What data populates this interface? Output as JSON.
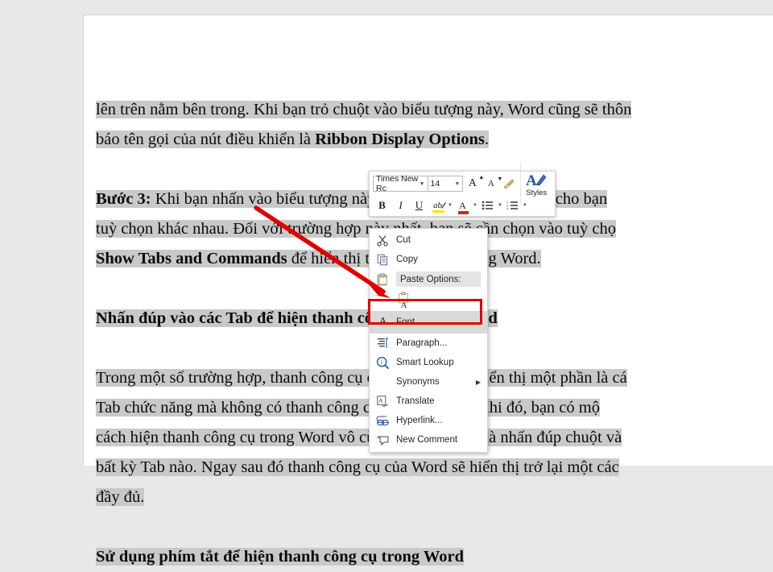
{
  "app": "Microsoft Word document with right-click context menu",
  "document": {
    "lines": [
      {
        "text": "lên trên nằm bên trong. Khi bạn trỏ chuột vào biểu tượng này, Word cũng sẽ thôn",
        "selected": true,
        "bold": false,
        "heading": false,
        "fullwidth": true
      },
      {
        "text": "báo tên gọi của nút điều khiển là ",
        "bold_tail": "Ribbon Display Options",
        "tail": ".",
        "selected": true,
        "bold": false,
        "heading": false,
        "fullwidth": false
      },
      {
        "text": "",
        "selected": false,
        "spacer": true
      },
      {
        "text_bold_lead": "Bước 3:",
        "text": " Khi bạn nhấn vào biểu tượng này trên Word, nó sẽ cung cấp cho bạn",
        "selected": true,
        "heading": false,
        "fullwidth": true
      },
      {
        "text": "tuỳ chọn khác nhau. Đối với trường hợp này nhất, bạn sẽ cần chọn vào tuỳ chọ",
        "selected": true,
        "heading": false,
        "fullwidth": true
      },
      {
        "text_bold_lead": "Show Tabs and Commands",
        "text": " để hiển thị thanh công cụ trong Word.",
        "selected": true,
        "heading": false,
        "fullwidth": false
      },
      {
        "text": "",
        "selected": false,
        "spacer": true
      },
      {
        "text": "Nhấn đúp vào các Tab để hiện thanh công cụ trong Word",
        "selected": true,
        "heading": true,
        "fullwidth": false
      },
      {
        "text": "",
        "selected": false,
        "spacer": true
      },
      {
        "text": "Trong một số trường hợp, thanh công cụ của Word sẽ chỉ hiển thị một phần là cá",
        "selected": true,
        "heading": false,
        "fullwidth": true
      },
      {
        "text": "Tab chức năng mà không có thanh công cụ nào bên dưới. Khi đó, bạn có mộ",
        "selected": true,
        "heading": false,
        "fullwidth": true
      },
      {
        "text": "cách hiện thanh công cụ trong Word vô cùng nhanh chóng là nhấn đúp chuột và",
        "selected": true,
        "heading": false,
        "fullwidth": true
      },
      {
        "text": "bất kỳ Tab nào. Ngay sau đó thanh công cụ của Word sẽ hiển thị trở lại một các",
        "selected": true,
        "heading": false,
        "fullwidth": true
      },
      {
        "text": "đầy đủ.",
        "selected": true,
        "heading": false,
        "fullwidth": false
      },
      {
        "text": "",
        "selected": false,
        "spacer": true
      },
      {
        "text": "Sử dụng phím tắt để hiện thanh công cụ trong Word",
        "selected": true,
        "heading": true,
        "fullwidth": false
      }
    ]
  },
  "minibar": {
    "font_name": "Times New Rc",
    "font_size": "14",
    "grow_font": "A",
    "shrink_font": "A",
    "format_painter": "format-painter",
    "styles_label": "Styles",
    "bold": "B",
    "italic": "I",
    "underline": "U",
    "highlight": "ab",
    "font_color": "A",
    "bullets": "bullet-list",
    "numbering": "numbered-list"
  },
  "context_menu": {
    "items": [
      {
        "label": "Cut",
        "icon": "scissors-icon",
        "underline_index": 1,
        "enabled": true,
        "submenu": false
      },
      {
        "label": "Copy",
        "icon": "copy-icon",
        "underline_index": 0,
        "enabled": true,
        "submenu": false
      },
      {
        "label": "Paste Options:",
        "icon": "paste-icon",
        "enabled": true,
        "submenu": false,
        "header": true
      },
      {
        "label": "",
        "icon": "paste-keep-text-icon",
        "enabled": true,
        "submenu": false,
        "icons_row": true
      },
      {
        "label": "Font...",
        "icon": "font-A-icon",
        "enabled": true,
        "submenu": false,
        "highlighted": true
      },
      {
        "label": "Paragraph...",
        "icon": "paragraph-icon",
        "enabled": true,
        "submenu": false
      },
      {
        "label": "Smart Lookup",
        "icon": "smart-lookup-icon",
        "enabled": true,
        "submenu": false
      },
      {
        "label": "Synonyms",
        "icon": "",
        "enabled": true,
        "submenu": true
      },
      {
        "label": "Translate",
        "icon": "translate-icon",
        "enabled": true,
        "submenu": false
      },
      {
        "label": "Hyperlink...",
        "icon": "hyperlink-icon",
        "enabled": true,
        "submenu": false
      },
      {
        "label": "New Comment",
        "icon": "new-comment-icon",
        "enabled": true,
        "submenu": false
      }
    ]
  },
  "annotations": {
    "highlight_color": "#e00000",
    "arrow_target": "Font...",
    "box_target": "Font..."
  },
  "colors": {
    "selection_gray": "#c9c9c9",
    "page_white": "#ffffff",
    "canvas_gray": "#e8e8e8",
    "annotation_red": "#e00000",
    "menu_highlight": "#d9d9d9"
  }
}
